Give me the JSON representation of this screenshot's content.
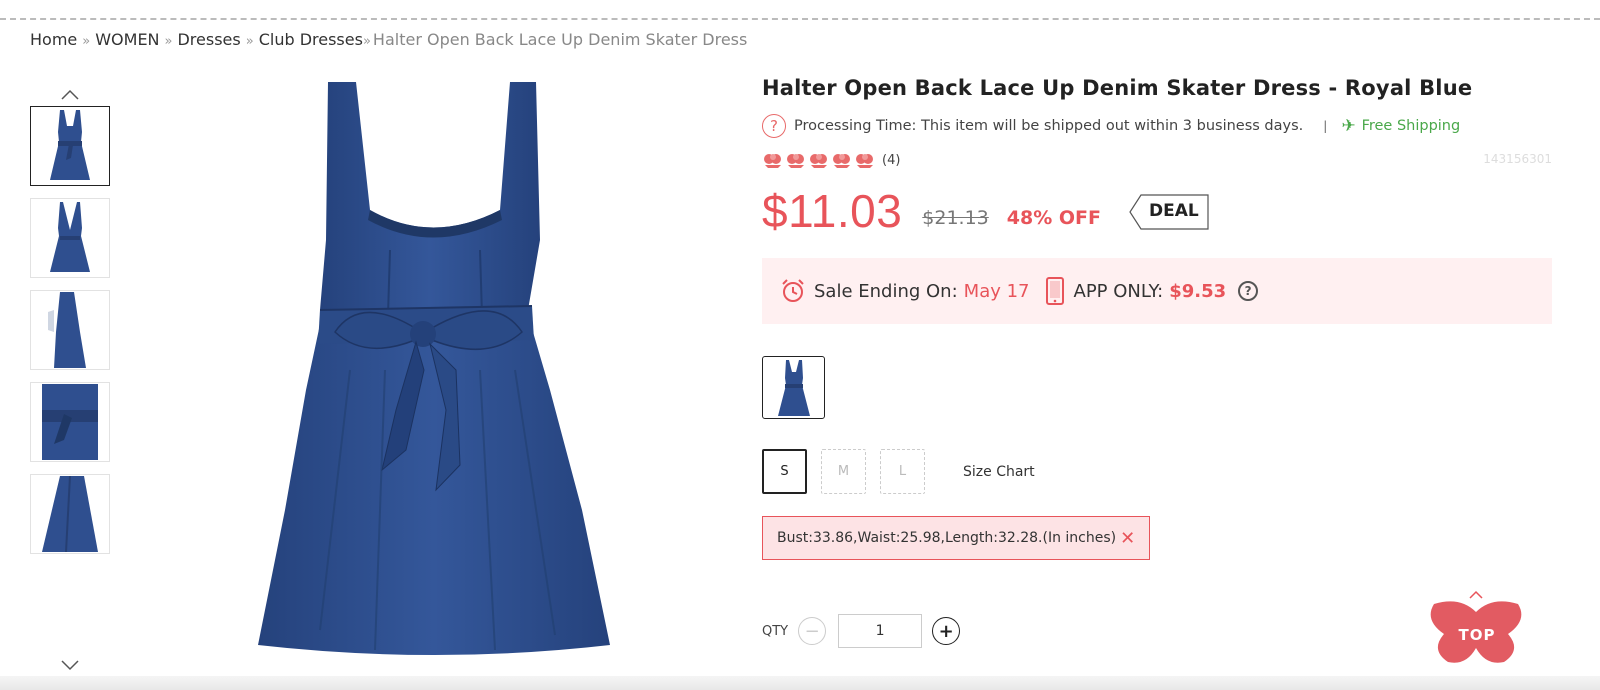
{
  "breadcrumb": {
    "items": [
      "Home",
      "WOMEN",
      "Dresses",
      "Club Dresses"
    ],
    "separator": "»",
    "current": "Halter Open Back Lace Up Denim Skater Dress"
  },
  "product": {
    "title": "Halter Open Back Lace Up Denim Skater Dress - Royal Blue",
    "processing_label": "Processing Time:",
    "processing_text": "This item will be shipped out within 3 business days.",
    "pipe": "|",
    "shipping": "Free Shipping",
    "rating_count": "(4)",
    "rating_value": 5,
    "sku": "143156301",
    "price": "$11.03",
    "old_price": "$21.13",
    "discount": "48% OFF",
    "deal_badge": "DEAL",
    "sale_ending_label": "Sale Ending On:",
    "sale_ending_date": "May 17",
    "app_only_label": "APP ONLY:",
    "app_only_price": "$9.53",
    "help": "?",
    "sizes": [
      {
        "label": "S",
        "state": "selected"
      },
      {
        "label": "M",
        "state": "disabled"
      },
      {
        "label": "L",
        "state": "disabled"
      }
    ],
    "size_chart": "Size Chart",
    "measurement": "Bust:33.86,Waist:25.98,Length:32.28.(In inches)",
    "qty_label": "QTY",
    "qty_value": "1"
  },
  "top_button": "TOP",
  "colors": {
    "accent": "#e8545a",
    "shipping_green": "#4aa84a",
    "denim": "#2f4f8f",
    "sale_bg": "#fff0f1"
  }
}
